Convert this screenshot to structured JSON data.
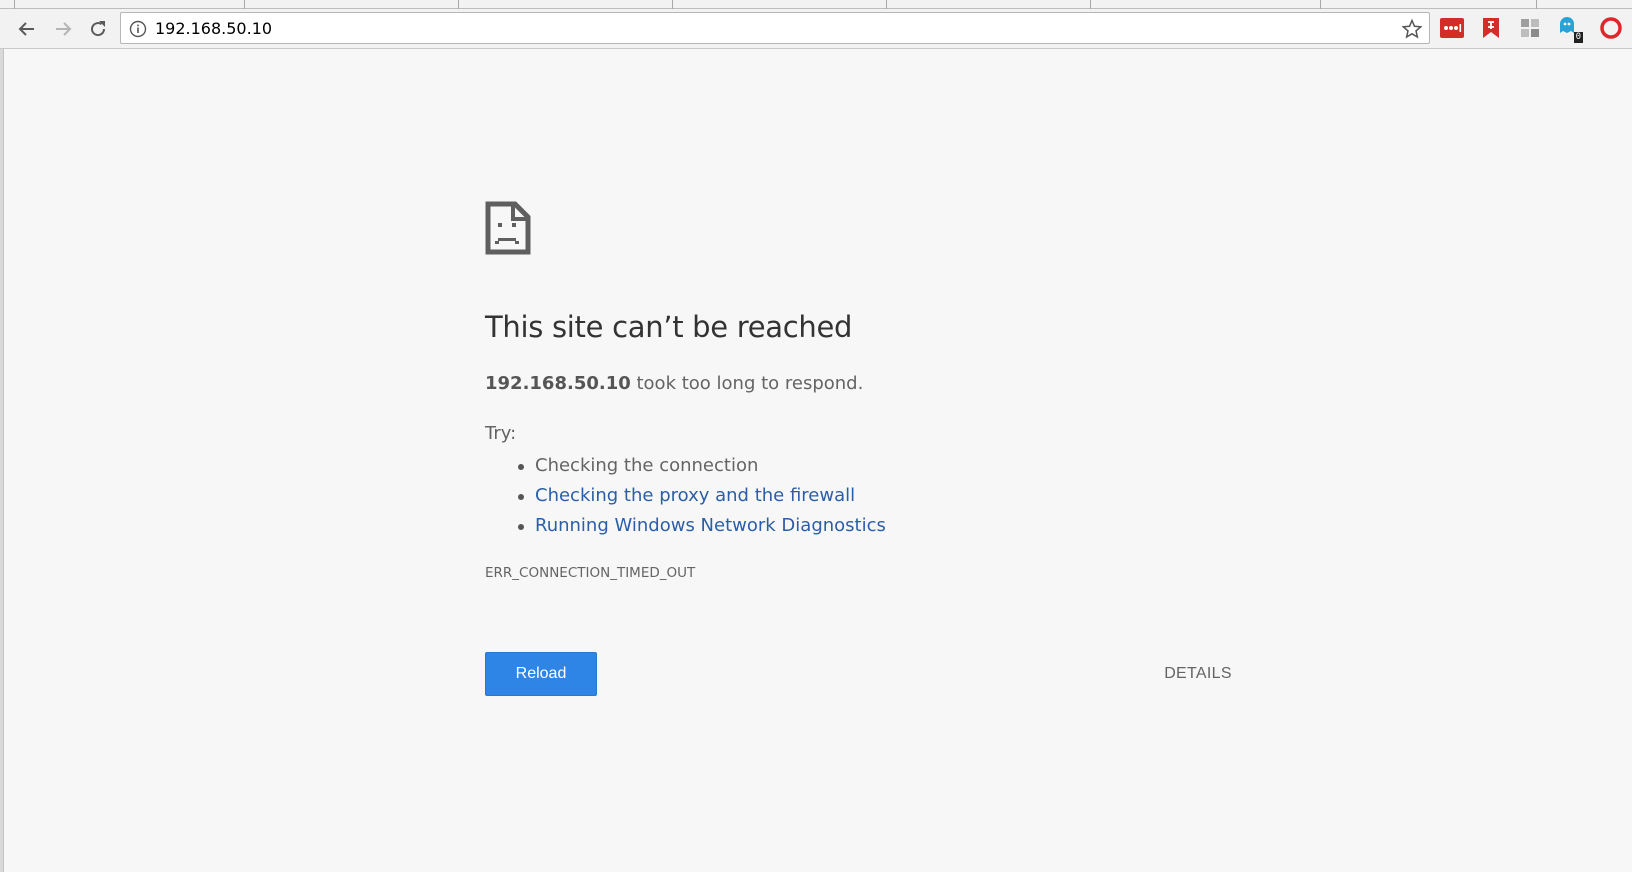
{
  "browser": {
    "address_bar": {
      "url": "192.168.50.10"
    },
    "extensions": {
      "ghostery_badge": "0"
    }
  },
  "error_page": {
    "heading": "This site can’t be reached",
    "host": "192.168.50.10",
    "summary_suffix": " took too long to respond.",
    "try_label": "Try:",
    "suggestions": [
      {
        "text": "Checking the connection",
        "link": false
      },
      {
        "text": "Checking the proxy and the firewall",
        "link": true
      },
      {
        "text": "Running Windows Network Diagnostics",
        "link": true
      }
    ],
    "error_code": "ERR_CONNECTION_TIMED_OUT",
    "reload_label": "Reload",
    "details_label": "DETAILS"
  },
  "colors": {
    "accent_button": "#2f85e5",
    "link": "#2b5ea8",
    "text": "#646464"
  }
}
